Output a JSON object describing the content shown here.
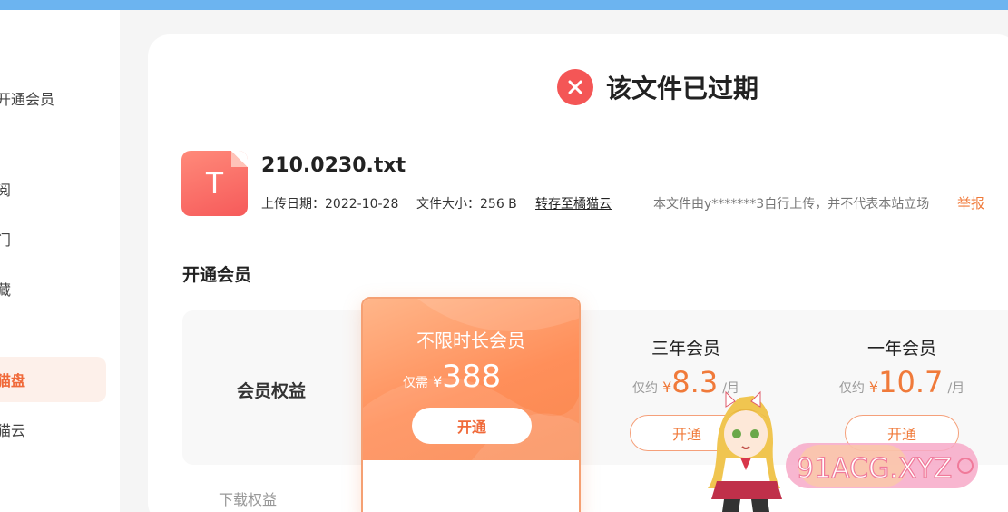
{
  "sidebar": {
    "items": [
      {
        "label": "开通会员"
      },
      {
        "label": "阅"
      },
      {
        "label": "门"
      },
      {
        "label": "藏"
      },
      {
        "label": "猫盘"
      },
      {
        "label": "猫云"
      }
    ]
  },
  "status": {
    "title": "该文件已过期"
  },
  "file": {
    "icon_letter": "T",
    "name": "210.0230.txt",
    "upload_date": "上传日期：2022-10-28",
    "size": "文件大小：256 B",
    "save_link": "转存至橘猫云",
    "disclaimer": "本文件由y*******3自行上传，并不代表本站立场",
    "report": "举报"
  },
  "membership": {
    "section_title": "开通会员",
    "benefit_label": "会员权益",
    "download_label": "下载权益",
    "featured": {
      "name": "不限时长会员",
      "price_prefix": "仅需",
      "currency": "¥",
      "price": "388",
      "button": "开通"
    },
    "plans": [
      {
        "name": "三年会员",
        "prefix": "仅约",
        "currency": "¥",
        "price": "8.3",
        "unit": "/月",
        "button": "开通"
      },
      {
        "name": "一年会员",
        "prefix": "仅约",
        "currency": "¥",
        "price": "10.7",
        "unit": "/月",
        "button": "开通"
      }
    ]
  },
  "watermark": {
    "text": "91ACG.XYZ"
  },
  "colors": {
    "topbar": "#6cb4f0",
    "accent": "#f07a3a",
    "error": "#f45656"
  }
}
